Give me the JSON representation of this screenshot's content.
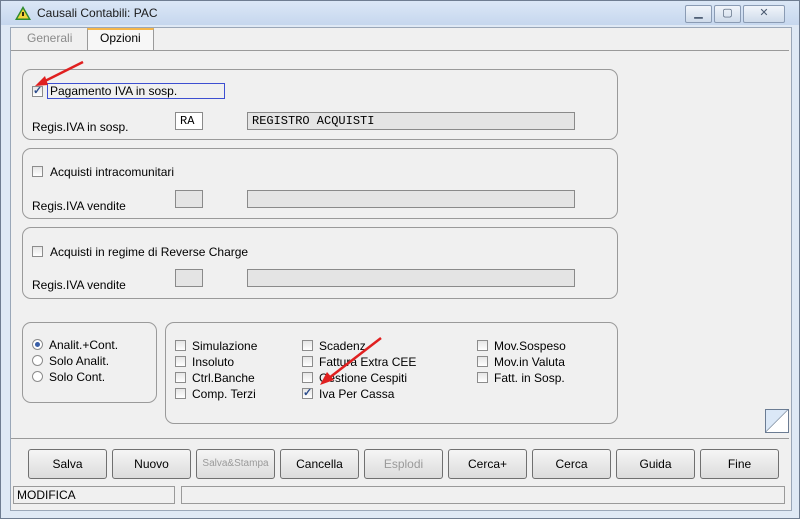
{
  "window": {
    "title": "Causali Contabili: PAC",
    "icon": "warning-triangle-icon"
  },
  "tabs": [
    {
      "label": "Generali"
    },
    {
      "label": "Opzioni"
    }
  ],
  "sections": {
    "pagamento": {
      "check_label": "Pagamento IVA in sosp.",
      "checked": true,
      "field_label": "Regis.IVA in sosp.",
      "code": "RA",
      "description": "REGISTRO ACQUISTI"
    },
    "intracom": {
      "check_label": "Acquisti intracomunitari",
      "checked": false,
      "field_label": "Regis.IVA vendite",
      "code": "",
      "description": ""
    },
    "reverse": {
      "check_label": "Acquisti in regime di Reverse Charge",
      "checked": false,
      "field_label": "Regis.IVA vendite",
      "code": "",
      "description": ""
    }
  },
  "radios": [
    {
      "label": "Analit.+Cont.",
      "selected": true
    },
    {
      "label": "Solo Analit.",
      "selected": false
    },
    {
      "label": "Solo Cont.",
      "selected": false
    }
  ],
  "options_col1": [
    {
      "label": "Simulazione",
      "checked": false
    },
    {
      "label": "Insoluto",
      "checked": false
    },
    {
      "label": "Ctrl.Banche",
      "checked": false
    },
    {
      "label": "Comp. Terzi",
      "checked": false
    }
  ],
  "options_col2": [
    {
      "label": "Scadenz",
      "checked": false
    },
    {
      "label": "Fattura Extra CEE",
      "checked": false
    },
    {
      "label": "Gestione Cespiti",
      "checked": false
    },
    {
      "label": "Iva Per Cassa",
      "checked": true
    }
  ],
  "options_col3": [
    {
      "label": "Mov.Sospeso",
      "checked": false
    },
    {
      "label": "Mov.in Valuta",
      "checked": false
    },
    {
      "label": "Fatt. in Sosp.",
      "checked": false
    }
  ],
  "buttons": {
    "salva": "Salva",
    "nuovo": "Nuovo",
    "salva_stampa": "Salva&Stampa",
    "cancella": "Cancella",
    "esplodi": "Esplodi",
    "cerca_plus": "Cerca+",
    "cerca": "Cerca",
    "guida": "Guida",
    "fine": "Fine"
  },
  "status": {
    "mode": "MODIFICA",
    "message": ""
  },
  "colors": {
    "annotation_arrow": "#e02020",
    "focus_border": "#3d4fd1",
    "active_tab_accent": "#f4b64a"
  }
}
